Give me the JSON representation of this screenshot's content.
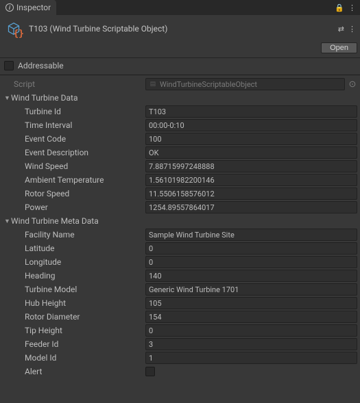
{
  "tabLabel": "Inspector",
  "header": {
    "title": "T103 (Wind Turbine Scriptable Object)",
    "openButton": "Open"
  },
  "addressable": {
    "label": "Addressable",
    "checked": false
  },
  "script": {
    "label": "Script",
    "value": "WindTurbineScriptableObject"
  },
  "sections": {
    "data": {
      "title": "Wind Turbine Data",
      "fields": {
        "turbineId": {
          "label": "Turbine Id",
          "value": "T103"
        },
        "timeInterval": {
          "label": "Time Interval",
          "value": "00:00-0:10"
        },
        "eventCode": {
          "label": "Event Code",
          "value": "100"
        },
        "eventDescription": {
          "label": "Event Description",
          "value": "OK"
        },
        "windSpeed": {
          "label": "Wind Speed",
          "value": "7.88715997248888"
        },
        "ambientTemperature": {
          "label": "Ambient Temperature",
          "value": "1.56101982200146"
        },
        "rotorSpeed": {
          "label": "Rotor Speed",
          "value": "11.5506158576012"
        },
        "power": {
          "label": "Power",
          "value": "1254.89557864017"
        }
      }
    },
    "meta": {
      "title": "Wind Turbine Meta Data",
      "fields": {
        "facilityName": {
          "label": "Facility Name",
          "value": "Sample Wind Turbine Site"
        },
        "latitude": {
          "label": "Latitude",
          "value": "0"
        },
        "longitude": {
          "label": "Longitude",
          "value": "0"
        },
        "heading": {
          "label": "Heading",
          "value": "140"
        },
        "turbineModel": {
          "label": "Turbine Model",
          "value": "Generic Wind Turbine 1701"
        },
        "hubHeight": {
          "label": "Hub Height",
          "value": "105"
        },
        "rotorDiameter": {
          "label": "Rotor Diameter",
          "value": "154"
        },
        "tipHeight": {
          "label": "Tip Height",
          "value": "0"
        },
        "feederId": {
          "label": "Feeder Id",
          "value": "3"
        },
        "modelId": {
          "label": "Model Id",
          "value": "1"
        },
        "alert": {
          "label": "Alert",
          "checked": false
        }
      }
    }
  }
}
